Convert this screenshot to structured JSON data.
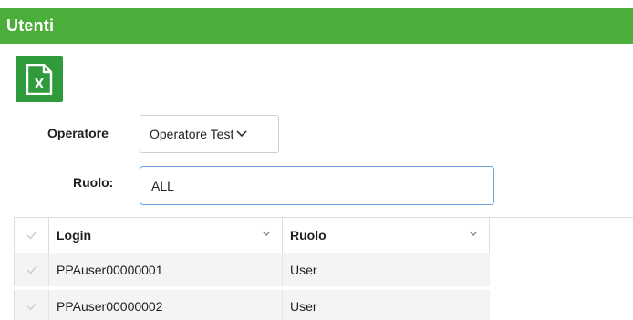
{
  "header": {
    "title": "Utenti"
  },
  "toolbar": {
    "excel_icon": "excel-export-icon",
    "excel_color": "#2f9b3c"
  },
  "form": {
    "operatore_label": "Operatore",
    "operatore_value": "Operatore Test",
    "ruolo_label": "Ruolo:",
    "ruolo_value": "ALL"
  },
  "grid": {
    "columns": [
      {
        "label": "Login"
      },
      {
        "label": "Ruolo"
      }
    ],
    "rows": [
      {
        "login": "PPAuser00000001",
        "ruolo": "User"
      },
      {
        "login": "PPAuser00000002",
        "ruolo": "User"
      }
    ]
  },
  "colors": {
    "header_bar": "#4cae3a",
    "input_focus_border": "#6aa6dd"
  }
}
